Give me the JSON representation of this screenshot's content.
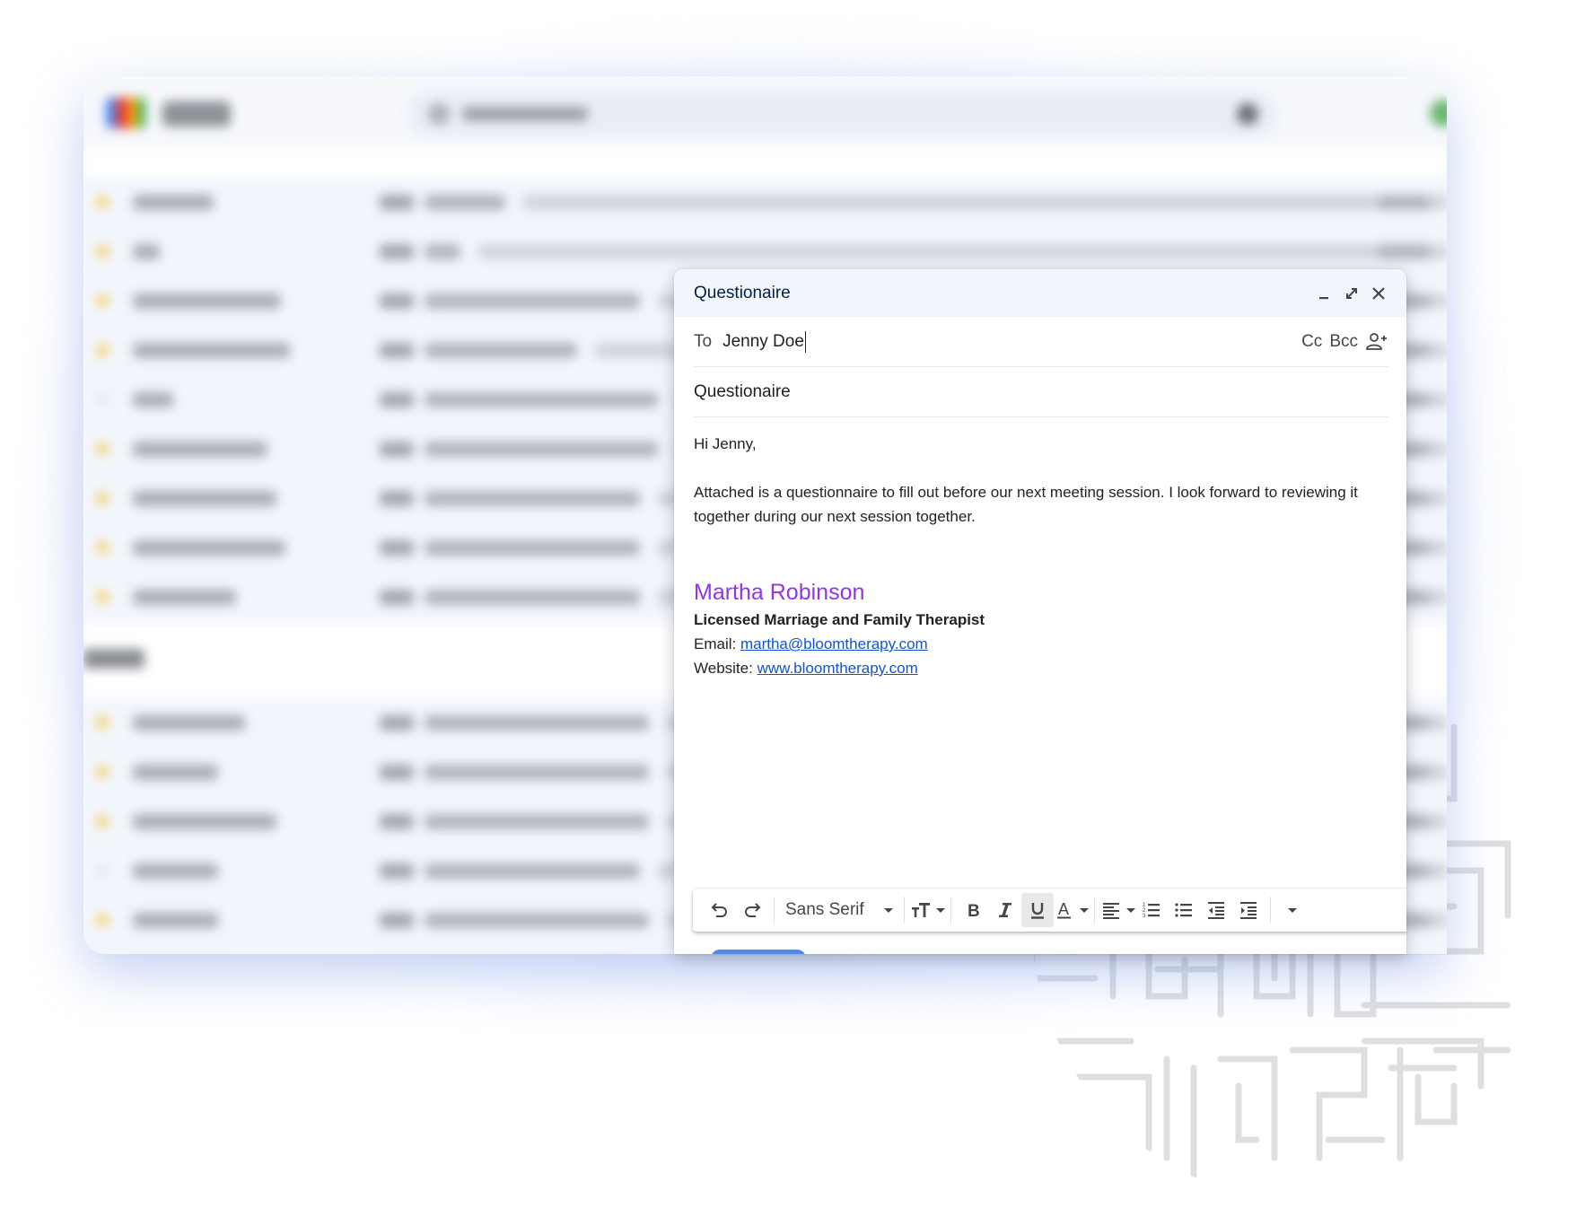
{
  "background_app": {
    "app_name": "Gmail",
    "search_placeholder": "Search in mail",
    "section_label": "Waiting",
    "rows_primary": 9,
    "rows_waiting": 6,
    "note": "blurred inbox list"
  },
  "compose": {
    "title": "Questionaire",
    "header_icons": [
      "minimize-icon",
      "expand-icon",
      "close-icon"
    ],
    "to_label": "To",
    "to_value": "Jenny Doe",
    "cc_label": "Cc",
    "bcc_label": "Bcc",
    "add_recipients_icon": "person-add-icon",
    "subject": "Questionaire",
    "body": {
      "greeting": "Hi Jenny,",
      "paragraph": "Attached is a questionnaire to fill out before our next meeting session. I look forward to reviewing it together during our next session together."
    },
    "signature": {
      "name": "Martha Robinson",
      "name_color": "#9334e6",
      "title": "Licensed Marriage and Family Therapist",
      "email_label": "Email:",
      "email": "martha@bloomtherapy.com",
      "website_label": "Website:",
      "website": "www.bloomtherapy.com",
      "link_color": "#1155cc"
    },
    "toolbar": {
      "undo": "undo-icon",
      "redo": "redo-icon",
      "font": "Sans Serif",
      "font_size": "text-size-icon",
      "bold": "bold-icon",
      "italic": "italic-icon",
      "underline": "underline-icon",
      "underline_active": true,
      "text_color": "text-color-icon",
      "align": "align-left-icon",
      "numbered_list": "numbered-list-icon",
      "bulleted_list": "bulleted-list-icon",
      "indent_less": "indent-less-icon",
      "indent_more": "indent-more-icon",
      "more": "more-formatting-icon"
    },
    "send_button_color": "#0b57d0"
  }
}
